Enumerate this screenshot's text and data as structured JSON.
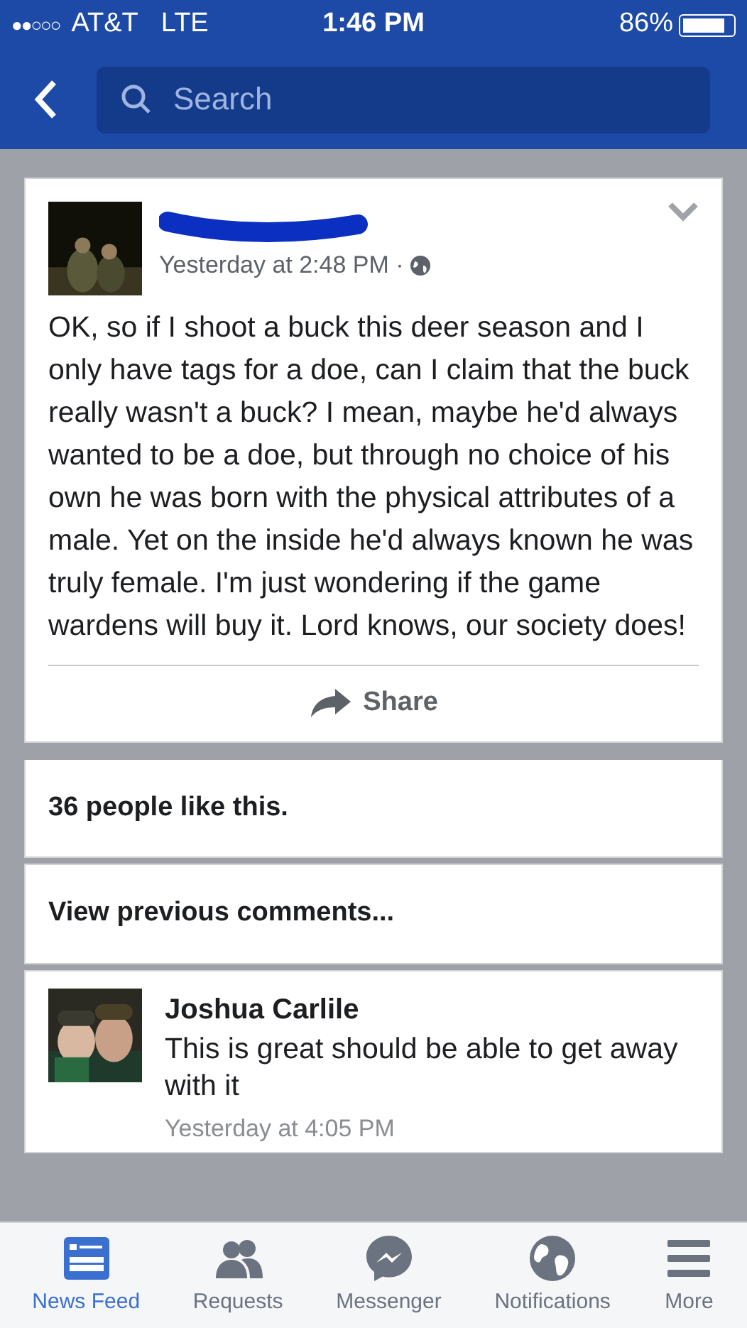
{
  "status_bar": {
    "signal_dots": "●●○○○",
    "carrier": "AT&T",
    "network": "LTE",
    "time": "1:46 PM",
    "battery_percent": "86%",
    "battery": {
      "level": 0.86
    }
  },
  "nav": {
    "search": {
      "placeholder": "Search"
    }
  },
  "post": {
    "author_redacted": true,
    "timestamp": "Yesterday at 2:48 PM ·",
    "text": "OK, so if I shoot a buck this deer season and I only have tags for a doe, can I claim that the buck really wasn't a buck? I mean, maybe he'd always wanted to be a doe, but through no choice of his own he was born with the physical attributes of a male. Yet on the inside he'd always known he was truly female. I'm just wondering if the game wardens will buy it. Lord knows, our society does!",
    "share": "Share"
  },
  "likes": "36 people like this.",
  "view_previous": "View previous comments...",
  "comments": [
    {
      "author": "Joshua Carlile",
      "text": "This is great should be able to get away with it",
      "timestamp": "Yesterday at 4:05 PM"
    }
  ],
  "tab_bar": [
    {
      "label": "News Feed",
      "kind": "feed",
      "selected": true
    },
    {
      "label": "Requests",
      "kind": "requests",
      "selected": false
    },
    {
      "label": "Messenger",
      "kind": "messenger",
      "selected": false
    },
    {
      "label": "Notifications",
      "kind": "notifications",
      "selected": false
    },
    {
      "label": "More",
      "kind": "more",
      "selected": false
    }
  ]
}
